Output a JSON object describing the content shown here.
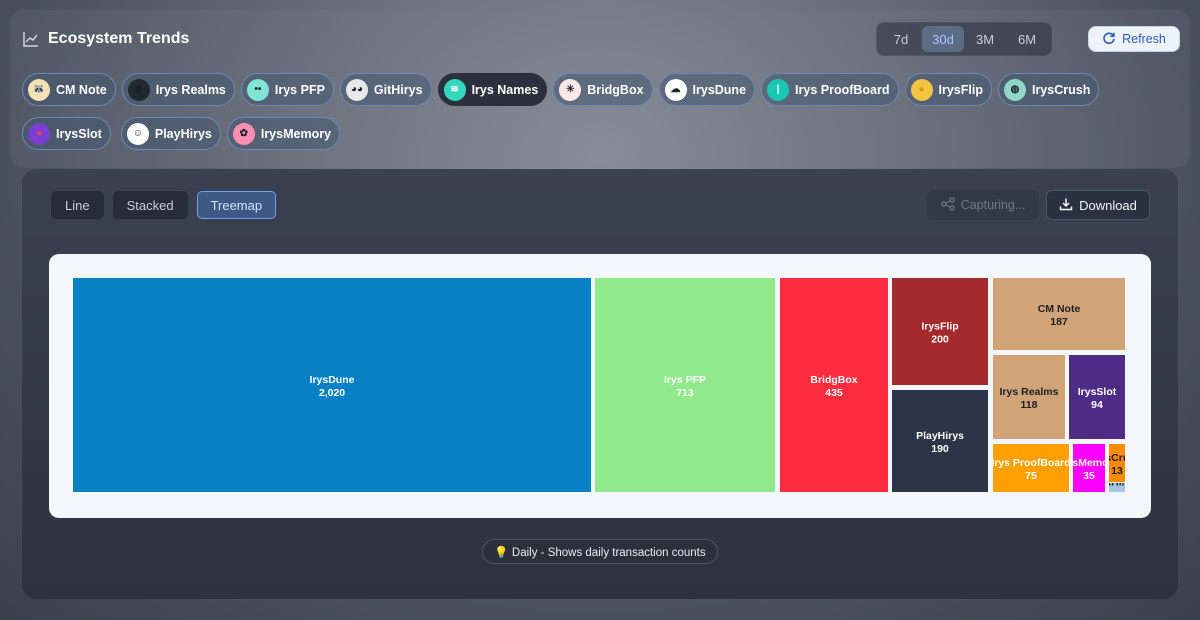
{
  "header": {
    "title": "Ecosystem Trends",
    "ranges": [
      "7d",
      "30d",
      "3M",
      "6M"
    ],
    "active_range": "30d",
    "refresh_label": "Refresh"
  },
  "projects": [
    {
      "label": "CM Note",
      "icon": "raccoon-avatar-icon",
      "color": "#f5e1b4"
    },
    {
      "label": "Irys Realms",
      "icon": "portal-icon",
      "color": "#1f2a2e"
    },
    {
      "label": "Irys PFP",
      "icon": "mint-face-icon",
      "color": "#7fe6d3"
    },
    {
      "label": "GitHirys",
      "icon": "panda-icon",
      "color": "#e8e8e8"
    },
    {
      "label": "Irys Names",
      "icon": "irys-logo-icon",
      "color": "#35d7c0"
    },
    {
      "label": "BridgBox",
      "icon": "bridge-box-icon",
      "color": "#fde9ea"
    },
    {
      "label": "IrysDune",
      "icon": "cloud-icon",
      "color": "#ffffff"
    },
    {
      "label": "Irys ProofBoard",
      "icon": "proof-icon",
      "color": "#19c8b4"
    },
    {
      "label": "IrysFlip",
      "icon": "coin-icon",
      "color": "#f5c542"
    },
    {
      "label": "IrysCrush",
      "icon": "crush-icon",
      "color": "#8fd6c8"
    },
    {
      "label": "IrysSlot",
      "icon": "slot-icon",
      "color": "#7a3fd1"
    },
    {
      "label": "PlayHirys",
      "icon": "ghost-icon",
      "color": "#ffffff"
    },
    {
      "label": "IrysMemory",
      "icon": "brain-icon",
      "color": "#ff8fb1"
    }
  ],
  "active_project": "Irys Names",
  "views": [
    "Line",
    "Stacked",
    "Treemap"
  ],
  "active_view": "Treemap",
  "capture_label": "Capturing...",
  "download_label": "Download",
  "hint": "💡 Daily - Shows daily transaction counts",
  "chart_data": {
    "type": "treemap",
    "items": [
      {
        "name": "IrysDune",
        "value": 2020,
        "label": "2,020",
        "color": "#0781c6"
      },
      {
        "name": "Irys PFP",
        "value": 713,
        "label": "713",
        "color": "#90ea8c"
      },
      {
        "name": "BridgBox",
        "value": 435,
        "label": "435",
        "color": "#ff2b3f"
      },
      {
        "name": "IrysFlip",
        "value": 200,
        "label": "200",
        "color": "#a3292b"
      },
      {
        "name": "PlayHirys",
        "value": 190,
        "label": "190",
        "color": "#2c3545"
      },
      {
        "name": "CM Note",
        "value": 187,
        "label": "187",
        "color": "#d1a377"
      },
      {
        "name": "Irys Realms",
        "value": 118,
        "label": "118",
        "color": "#d1a377"
      },
      {
        "name": "IrysSlot",
        "value": 94,
        "label": "94",
        "color": "#4d2b86"
      },
      {
        "name": "Irys ProofBoard",
        "value": 75,
        "label": "75",
        "color": "#ff9f00"
      },
      {
        "name": "IrysMemory",
        "value": 35,
        "label": "35",
        "color": "#ff00ff"
      },
      {
        "name": "IrysCrush",
        "value": 13,
        "label": "13",
        "color": "#ff8c00"
      },
      {
        "name": "GitHirys",
        "value": null,
        "label": "",
        "color": "#a8c8e0"
      }
    ]
  }
}
